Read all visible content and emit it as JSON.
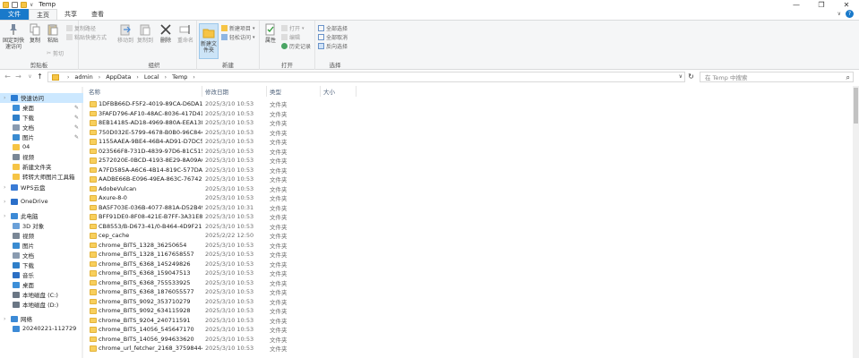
{
  "window": {
    "title": "Temp",
    "minimize": "—",
    "maximize": "❐",
    "close": "✕"
  },
  "tabs": [
    {
      "label": "文件"
    },
    {
      "label": "主页"
    },
    {
      "label": "共享"
    },
    {
      "label": "查看"
    }
  ],
  "ribbon": {
    "clipboard": {
      "pin_label": "固定到快速访问",
      "copy_label": "复制",
      "paste_label": "粘贴",
      "copy_path": "复制路径",
      "paste_shortcut": "粘贴快捷方式",
      "cut": "剪切",
      "group": "剪贴板"
    },
    "organize": {
      "move_to": "移动到",
      "copy_to": "复制到",
      "delete": "删除",
      "rename": "重命名",
      "group": "组织"
    },
    "new": {
      "new_folder": "新建文件夹",
      "new_item": "新建项目",
      "easy_access": "轻松访问",
      "group": "新建"
    },
    "open": {
      "properties": "属性",
      "open": "打开",
      "edit": "编辑",
      "history": "历史记录",
      "group": "打开"
    },
    "select": {
      "select_all": "全部选择",
      "select_none": "全部取消",
      "invert": "反向选择",
      "group": "选择"
    }
  },
  "address": {
    "crumbs": [
      "admin",
      "AppData",
      "Local",
      "Temp"
    ],
    "search_placeholder": "在 Temp 中搜索"
  },
  "sidebar": {
    "items": [
      {
        "label": "快速访问",
        "icon": "star-icon",
        "color": "#2b7cd3",
        "indent": 0,
        "chev": "",
        "pin": false
      },
      {
        "label": "桌面",
        "icon": "desktop-icon",
        "color": "#3d8fd8",
        "indent": 1,
        "pin": true
      },
      {
        "label": "下载",
        "icon": "download-icon",
        "color": "#2f7fc9",
        "indent": 1,
        "pin": true
      },
      {
        "label": "文档",
        "icon": "document-icon",
        "color": "#8a9bb0",
        "indent": 1,
        "pin": true
      },
      {
        "label": "图片",
        "icon": "picture-icon",
        "color": "#3a8bd1",
        "indent": 1,
        "pin": true
      },
      {
        "label": "04",
        "icon": "folder-icon",
        "color": "#f6c445",
        "indent": 1,
        "pin": false
      },
      {
        "label": "视频",
        "icon": "video-icon",
        "color": "#7a8796",
        "indent": 1,
        "pin": false
      },
      {
        "label": "新建文件夹",
        "icon": "folder-icon",
        "color": "#f6c445",
        "indent": 1,
        "pin": false
      },
      {
        "label": "转转大师图片工具箱",
        "icon": "folder-icon",
        "color": "#f6c445",
        "indent": 1,
        "pin": false
      },
      {
        "label": "WPS云盘",
        "icon": "cloud-icon",
        "color": "#3a7bd5",
        "indent": 0,
        "pin": false
      },
      {
        "label": "OneDrive",
        "icon": "onedrive-icon",
        "color": "#2a6fc9",
        "indent": 0,
        "pin": false
      },
      {
        "label": "此电脑",
        "icon": "computer-icon",
        "color": "#3c8ad6",
        "indent": 0,
        "pin": false
      },
      {
        "label": "3D 对象",
        "icon": "3d-objects-icon",
        "color": "#6aa0d8",
        "indent": 1,
        "pin": false
      },
      {
        "label": "视频",
        "icon": "video-icon",
        "color": "#7a8796",
        "indent": 1,
        "pin": false
      },
      {
        "label": "图片",
        "icon": "picture-icon",
        "color": "#3a8bd1",
        "indent": 1,
        "pin": false
      },
      {
        "label": "文档",
        "icon": "document-icon",
        "color": "#8a9bb0",
        "indent": 1,
        "pin": false
      },
      {
        "label": "下载",
        "icon": "download-icon",
        "color": "#2f7fc9",
        "indent": 1,
        "pin": false
      },
      {
        "label": "音乐",
        "icon": "music-icon",
        "color": "#2b6fc4",
        "indent": 1,
        "pin": false
      },
      {
        "label": "桌面",
        "icon": "desktop-icon",
        "color": "#3d8fd8",
        "indent": 1,
        "pin": false
      },
      {
        "label": "本地磁盘 (C:)",
        "icon": "drive-icon",
        "color": "#6b7785",
        "indent": 1,
        "pin": false
      },
      {
        "label": "本地磁盘 (D:)",
        "icon": "drive-icon",
        "color": "#6b7785",
        "indent": 1,
        "pin": false
      },
      {
        "label": "网络",
        "icon": "network-icon",
        "color": "#3c8ad6",
        "indent": 0,
        "pin": false
      },
      {
        "label": "20240221-112729",
        "icon": "computer-icon",
        "color": "#3c8ad6",
        "indent": 1,
        "pin": false
      }
    ]
  },
  "columns": {
    "name": "名称",
    "date": "修改日期",
    "type": "类型",
    "size": "大小"
  },
  "files": [
    {
      "name": "1DFBB66D-F5F2-4019-89CA-D6DA16...",
      "date": "2025/3/10 10:53",
      "type": "文件夹"
    },
    {
      "name": "3FAFD796-AF10-48AC-8036-417D417...",
      "date": "2025/3/10 10:53",
      "type": "文件夹"
    },
    {
      "name": "8EB14185-AD18-4969-880A-EEA138...",
      "date": "2025/3/10 10:53",
      "type": "文件夹"
    },
    {
      "name": "750D032E-5799-4678-B0B0-96C8448...",
      "date": "2025/3/10 10:53",
      "type": "文件夹"
    },
    {
      "name": "1155AAEA-9BE4-46B4-AD91-D7DC5E...",
      "date": "2025/3/10 10:53",
      "type": "文件夹"
    },
    {
      "name": "023566F8-731D-4839-97D6-81C5157...",
      "date": "2025/3/10 10:53",
      "type": "文件夹"
    },
    {
      "name": "2572020E-0BCD-4193-8E29-8A09A62...",
      "date": "2025/3/10 10:53",
      "type": "文件夹"
    },
    {
      "name": "A7FD585A-A6C6-4B14-819C-577DAA...",
      "date": "2025/3/10 10:53",
      "type": "文件夹"
    },
    {
      "name": "AADBE66B-E096-49EA-863C-7674241...",
      "date": "2025/3/10 10:53",
      "type": "文件夹"
    },
    {
      "name": "AdobeVulcan",
      "date": "2025/3/10 10:53",
      "type": "文件夹"
    },
    {
      "name": "Axure-8-0",
      "date": "2025/3/10 10:53",
      "type": "文件夹"
    },
    {
      "name": "BA5F703E-036B-4077-881A-D52B49E...",
      "date": "2025/3/10 10:31",
      "type": "文件夹"
    },
    {
      "name": "BFF91DE0-8F08-421E-B7FF-3A31E831...",
      "date": "2025/3/10 10:53",
      "type": "文件夹"
    },
    {
      "name": "CB8553/B-D673-41/0-B464-4D9F216...",
      "date": "2025/3/10 10:53",
      "type": "文件夹"
    },
    {
      "name": "cep_cache",
      "date": "2025/2/22 12:50",
      "type": "文件夹"
    },
    {
      "name": "chrome_BITS_1328_36250654",
      "date": "2025/3/10 10:53",
      "type": "文件夹"
    },
    {
      "name": "chrome_BITS_1328_1167658557",
      "date": "2025/3/10 10:53",
      "type": "文件夹"
    },
    {
      "name": "chrome_BITS_6368_145249826",
      "date": "2025/3/10 10:53",
      "type": "文件夹"
    },
    {
      "name": "chrome_BITS_6368_159047513",
      "date": "2025/3/10 10:53",
      "type": "文件夹"
    },
    {
      "name": "chrome_BITS_6368_755533925",
      "date": "2025/3/10 10:53",
      "type": "文件夹"
    },
    {
      "name": "chrome_BITS_6368_1876055577",
      "date": "2025/3/10 10:53",
      "type": "文件夹"
    },
    {
      "name": "chrome_BITS_9092_353710279",
      "date": "2025/3/10 10:53",
      "type": "文件夹"
    },
    {
      "name": "chrome_BITS_9092_634115928",
      "date": "2025/3/10 10:53",
      "type": "文件夹"
    },
    {
      "name": "chrome_BITS_9204_240711591",
      "date": "2025/3/10 10:53",
      "type": "文件夹"
    },
    {
      "name": "chrome_BITS_14056_545647170",
      "date": "2025/3/10 10:53",
      "type": "文件夹"
    },
    {
      "name": "chrome_BITS_14056_994633620",
      "date": "2025/3/10 10:53",
      "type": "文件夹"
    },
    {
      "name": "chrome_url_fetcher_2168_375984443",
      "date": "2025/3/10 10:53",
      "type": "文件夹"
    }
  ]
}
